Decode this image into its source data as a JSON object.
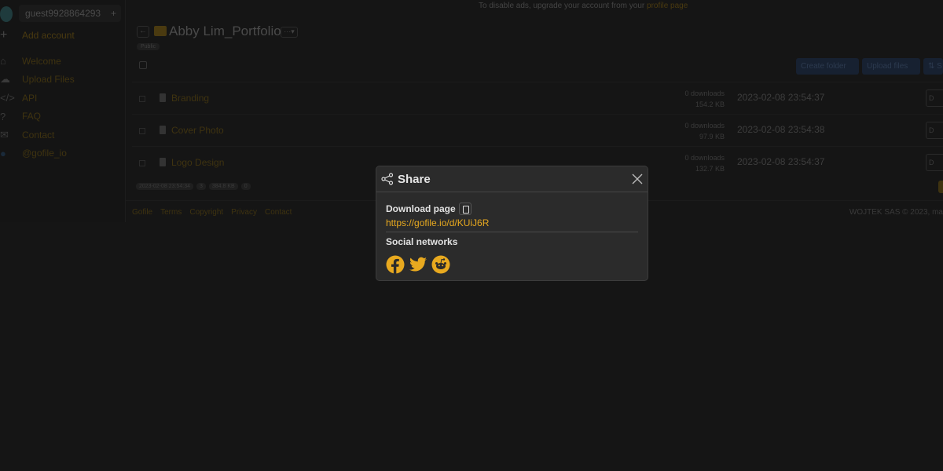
{
  "ad": {
    "text": "To disable ads, upgrade your account from your ",
    "link": "profile page"
  },
  "sidebar": {
    "account": "guest9928864293",
    "add_account": "Add account",
    "items": [
      {
        "label": "Welcome",
        "icon": "home-icon"
      },
      {
        "label": "Upload Files",
        "icon": "upload-icon"
      },
      {
        "label": "API",
        "icon": "code-icon"
      },
      {
        "label": "FAQ",
        "icon": "question-icon"
      },
      {
        "label": "Contact",
        "icon": "envelope-icon"
      },
      {
        "label": "@gofile_io",
        "icon": "twitter-icon"
      }
    ]
  },
  "folder": {
    "title": "Abby Lim_Portfolio",
    "menu": "···▾",
    "visibility": "Public",
    "toolbar": {
      "create": "Create folder",
      "upload": "Upload files",
      "sort": "⇅ S"
    },
    "files": [
      {
        "name": "Branding",
        "downloads": "0 downloads",
        "size": "154.2 KB",
        "date": "2023-02-08 23:54:37",
        "action": "D"
      },
      {
        "name": "Cover Photo",
        "downloads": "0 downloads",
        "size": "97.9 KB",
        "date": "2023-02-08 23:54:38",
        "action": "D"
      },
      {
        "name": "Logo Design",
        "downloads": "0 downloads",
        "size": "132.7 KB",
        "date": "2023-02-08 23:54:37",
        "action": "D"
      }
    ],
    "badges": {
      "date": "2023-02-08 23:54:34",
      "count": "3",
      "size": "384.8 KB",
      "downloads": "0"
    }
  },
  "footer": {
    "links": [
      "Gofile",
      "Terms",
      "Copyright",
      "Privacy",
      "Contact"
    ],
    "copyright": "WOJTEK SAS © 2023, ma"
  },
  "modal": {
    "title": "Share",
    "download_label": "Download page",
    "url": "https://gofile.io/d/KUiJ6R",
    "social_label": "Social networks",
    "accent": "#e8a91f",
    "networks": [
      "facebook-icon",
      "twitter-icon",
      "reddit-icon"
    ]
  }
}
